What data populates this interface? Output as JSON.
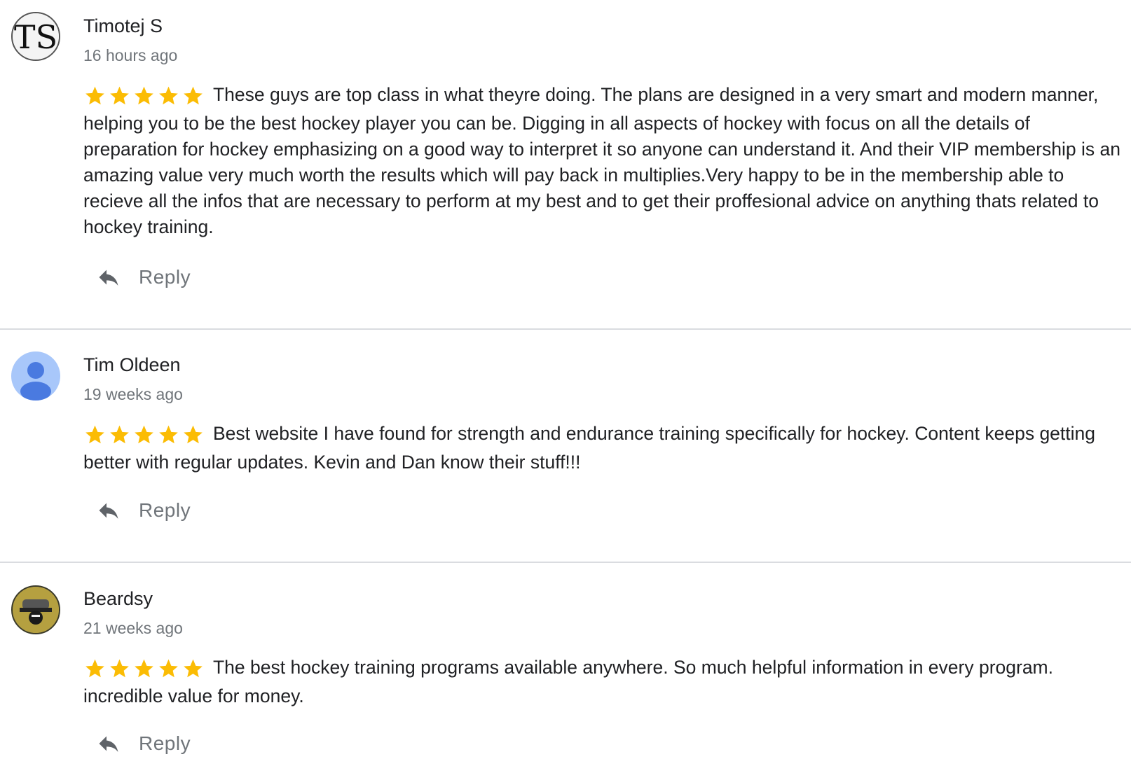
{
  "reviews": [
    {
      "author": "Timotej S",
      "avatar_initials": "TS",
      "avatar_type": "initials-monogram",
      "time_ago": "16 hours ago",
      "rating": 5,
      "text": "These guys are top class in what theyre doing. The plans are designed in a very smart and modern manner, helping you to be the best hockey player you can be. Digging in all aspects of hockey with focus on all the details of preparation for hockey emphasizing on a good way to interpret it so anyone can understand it. And their VIP membership is an amazing value very much worth the results which will pay back in multiplies.Very happy to be in the membership able to recieve all the infos that are necessary to perform at my best and to get their proffesional advice on anything thats related to hockey training.",
      "reply_label": "Reply"
    },
    {
      "author": "Tim Oldeen",
      "avatar_type": "default-person-icon",
      "time_ago": "19 weeks ago",
      "rating": 5,
      "text": "Best website I have found for strength and endurance training specifically for hockey. Content keeps getting better with regular updates. Kevin and Dan know their stuff!!!",
      "reply_label": "Reply"
    },
    {
      "author": "Beardsy",
      "avatar_type": "photo-logo",
      "time_ago": "21 weeks ago",
      "rating": 5,
      "text": "The best hockey training programs available anywhere. So much helpful information in every program. incredible value for money.",
      "reply_label": "Reply"
    }
  ],
  "colors": {
    "star": "#fbbc04",
    "name": "#202124",
    "secondary": "#70757a",
    "divider": "#dadce0",
    "default_avatar_bg": "#a8c7fa",
    "default_avatar_fg": "#4a7ae0"
  },
  "icons": {
    "star": "star-icon",
    "reply": "reply-arrow-icon"
  }
}
